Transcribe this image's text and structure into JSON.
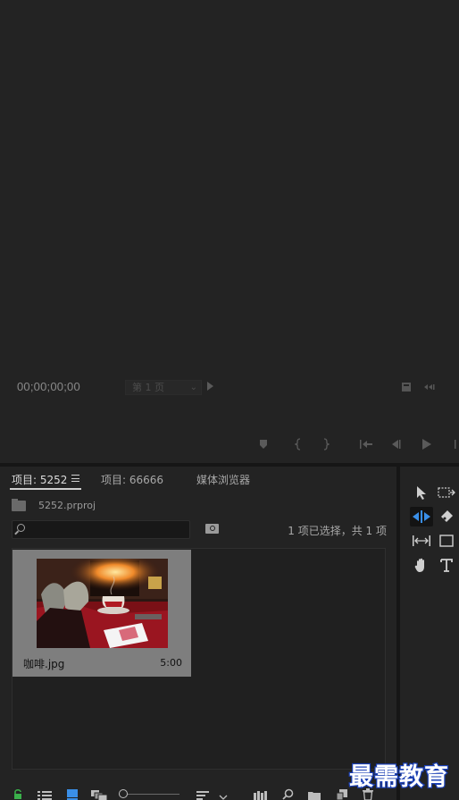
{
  "program_monitor": {
    "timecode": "00;00;00;00",
    "page_select": {
      "value": "第 1 页"
    }
  },
  "project_panel": {
    "tabs": [
      {
        "label": "项目: 5252",
        "active": true
      },
      {
        "label": "项目: 66666",
        "active": false
      },
      {
        "label": "媒体浏览器",
        "active": false
      }
    ],
    "project_file": "5252.prproj",
    "search": {
      "value": "",
      "placeholder": ""
    },
    "selection_status": "1 项已选择，共 1 项",
    "clips": [
      {
        "name": "咖啡.jpg",
        "duration": "5:00"
      }
    ]
  },
  "tools": [
    "selection-tool",
    "track-select-tool",
    "ripple-edit-tool",
    "razor-tool",
    "slip-tool",
    "rectangle-tool",
    "hand-tool",
    "type-tool"
  ],
  "watermark": "最需教育",
  "colors": {
    "active_tool": "#3a8fe8",
    "lock_icon": "#3ab04a",
    "list_view_icon": "#3a8fe8",
    "watermark_stroke": "#1a3fb5"
  }
}
